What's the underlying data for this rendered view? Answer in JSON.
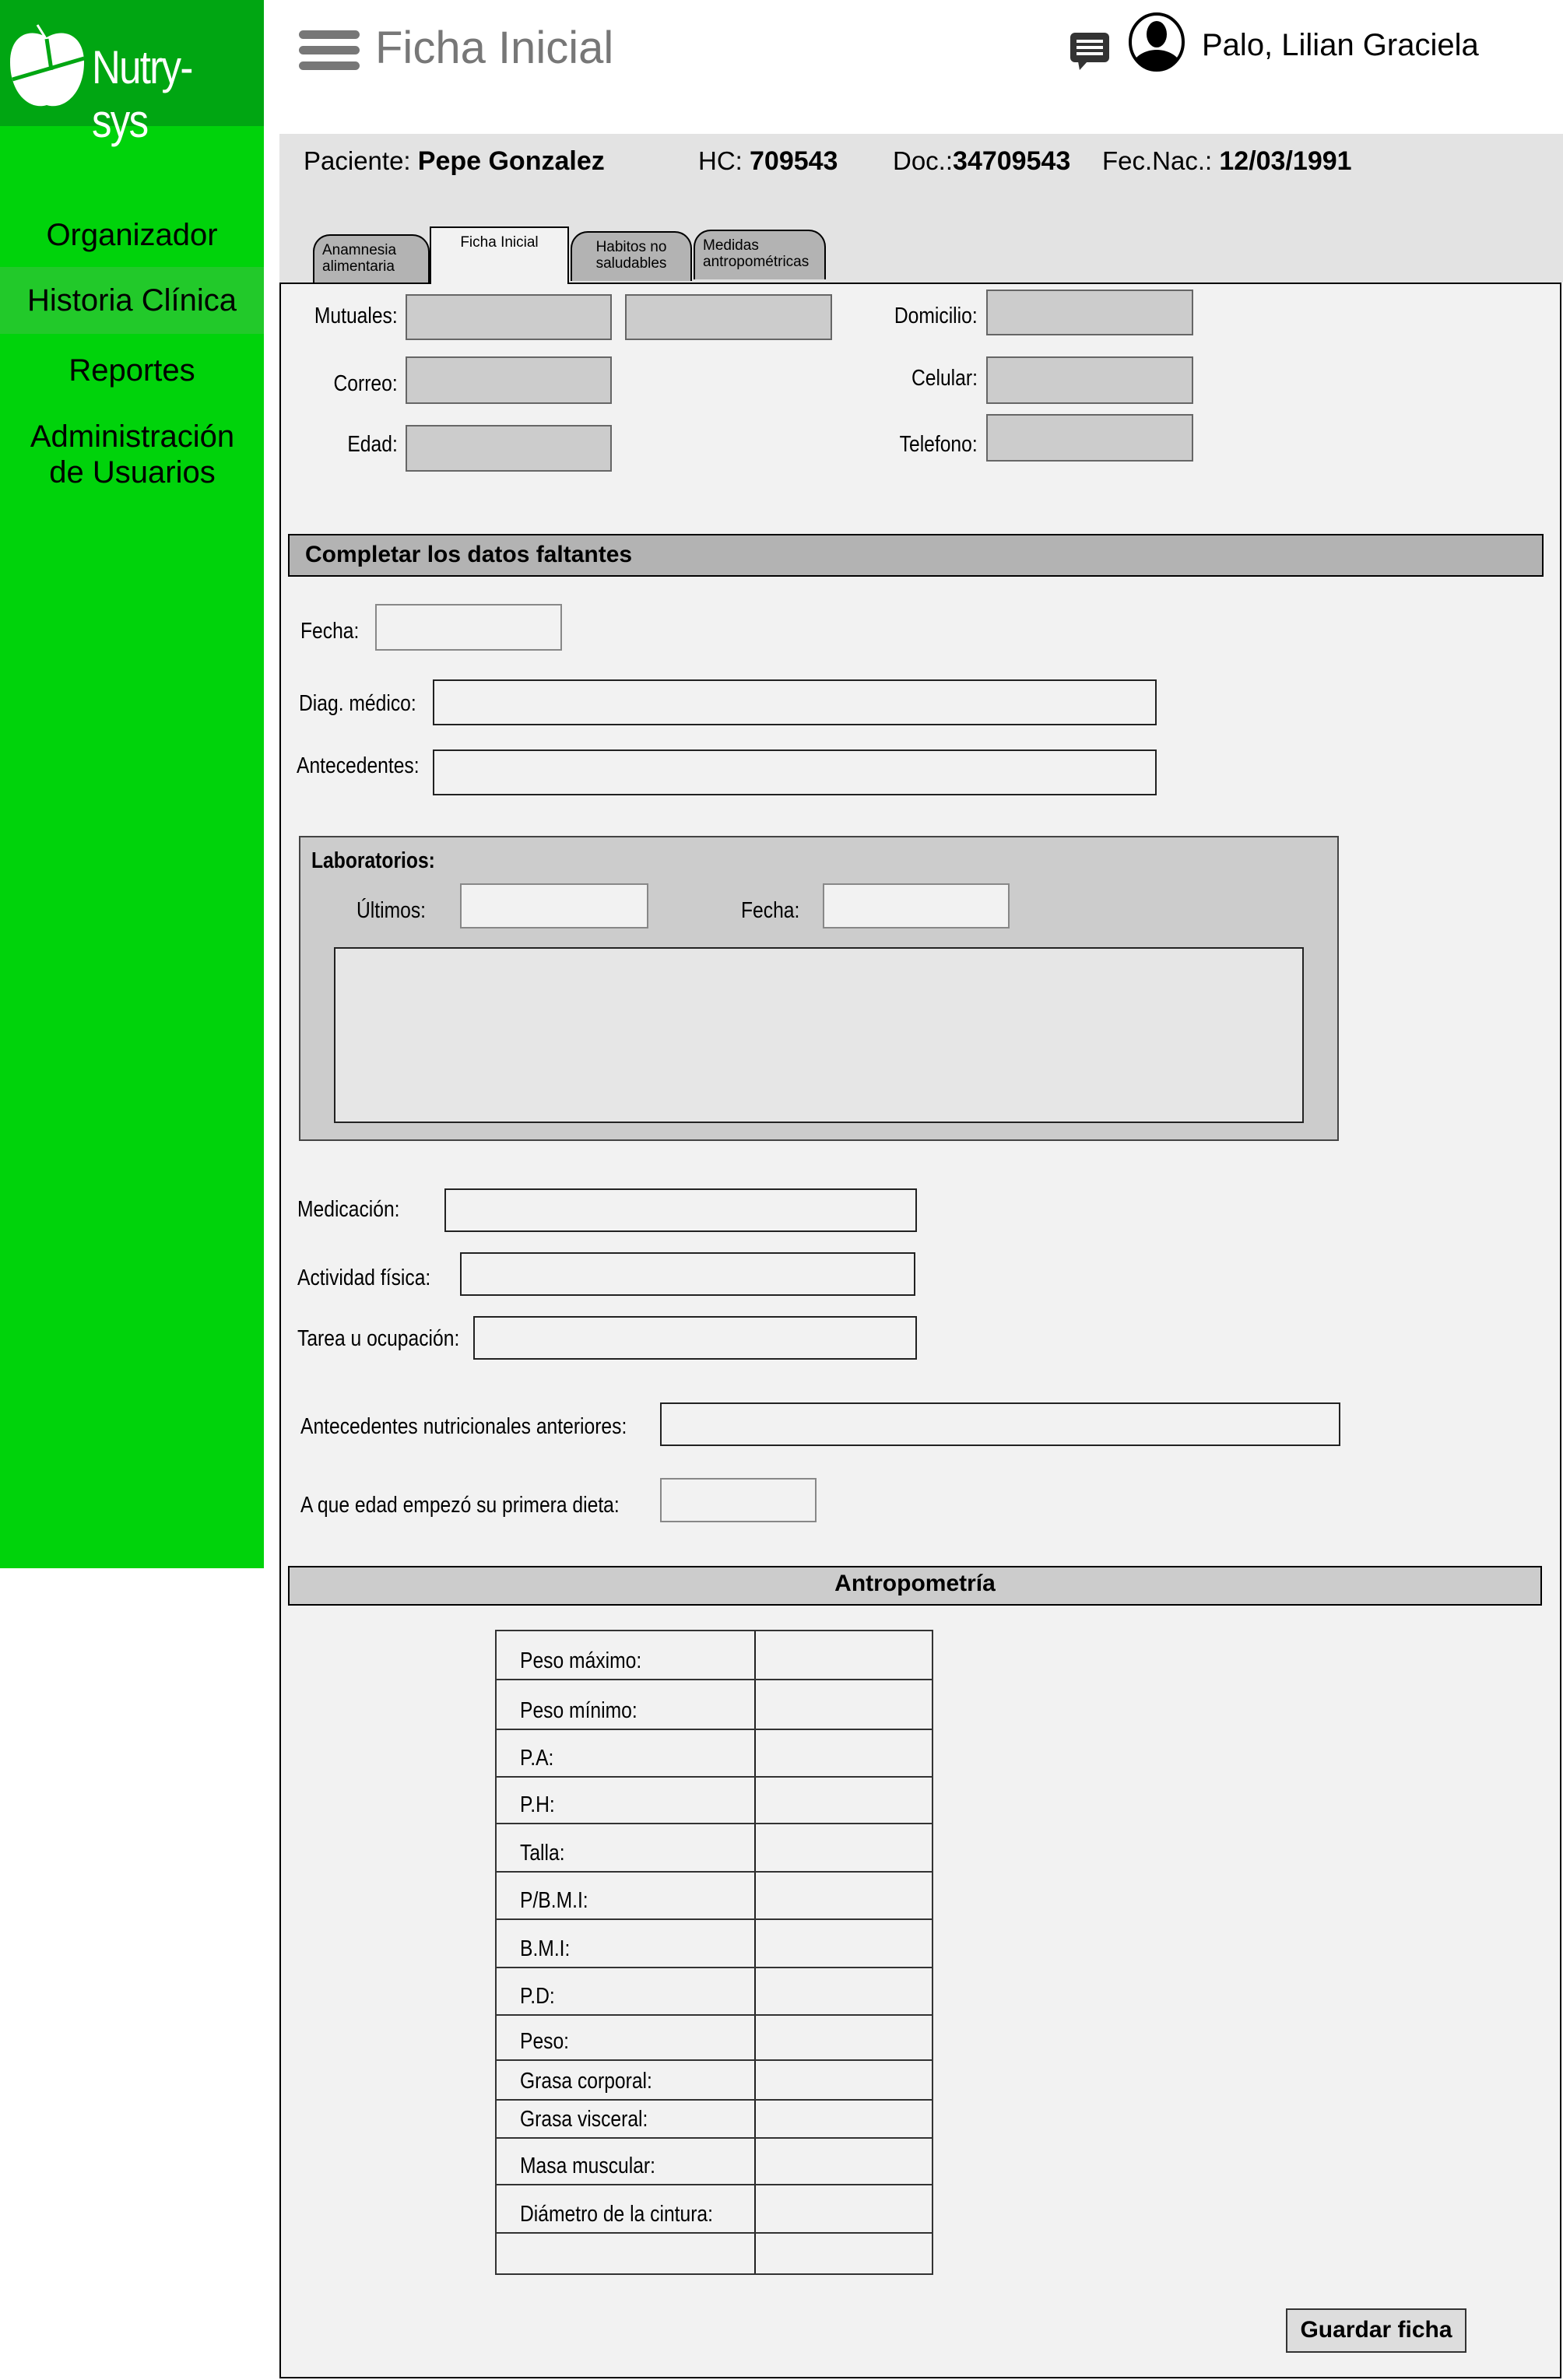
{
  "app": {
    "name": "Nutry-sys",
    "brand_color": "#00d30b",
    "brand_dark": "#00a612"
  },
  "sidebar": {
    "items": [
      {
        "label": "Organizador"
      },
      {
        "label": "Historia Clínica",
        "active": true
      },
      {
        "label": "Reportes"
      },
      {
        "label": "Administración de Usuarios"
      }
    ]
  },
  "header": {
    "title": "Ficha Inicial",
    "user_name": "Palo, Lilian Graciela",
    "icons": [
      "menu-icon",
      "chat-icon",
      "user-avatar-icon"
    ]
  },
  "patient": {
    "name_label": "Paciente:",
    "name": "Pepe Gonzalez",
    "hc_label": "HC:",
    "hc": "709543",
    "doc_label": "Doc.:",
    "doc": "34709543",
    "dob_label": "Fec.Nac.:",
    "dob": "12/03/1991"
  },
  "tabs": [
    {
      "label": "Anamnesia alimentaria"
    },
    {
      "label": "Ficha Inicial",
      "active": true
    },
    {
      "label": "Habitos no saludables"
    },
    {
      "label": "Medidas antropométricas"
    }
  ],
  "contact": {
    "mutuales": "Mutuales:",
    "correo": "Correo:",
    "edad": "Edad:",
    "domicilio": "Domicilio:",
    "celular": "Celular:",
    "telefono": "Telefono:"
  },
  "completar": {
    "title": "Completar los datos faltantes",
    "fecha": "Fecha:",
    "diag": "Diag. médico:",
    "antecedentes": "Antecedentes:",
    "lab": {
      "title": "Laboratorios:",
      "ultimos": "Últimos:",
      "fecha": "Fecha:"
    },
    "medicacion": "Medicación:",
    "actividad": "Actividad física:",
    "tarea": "Tarea u ocupación:",
    "ant_nutri": "Antecedentes nutricionales anteriores:",
    "edad_dieta": "A que edad empezó su primera dieta:"
  },
  "antropometria": {
    "title": "Antropometría",
    "rows": [
      "Peso máximo:",
      "Peso mínimo:",
      "P.A:",
      "P.H:",
      "Talla:",
      "P/B.M.I:",
      "B.M.I:",
      "P.D:",
      "Peso:",
      "Grasa corporal:",
      "Grasa visceral:",
      "Masa muscular:",
      "Diámetro de la cintura:",
      ""
    ]
  },
  "actions": {
    "save": "Guardar ficha"
  }
}
